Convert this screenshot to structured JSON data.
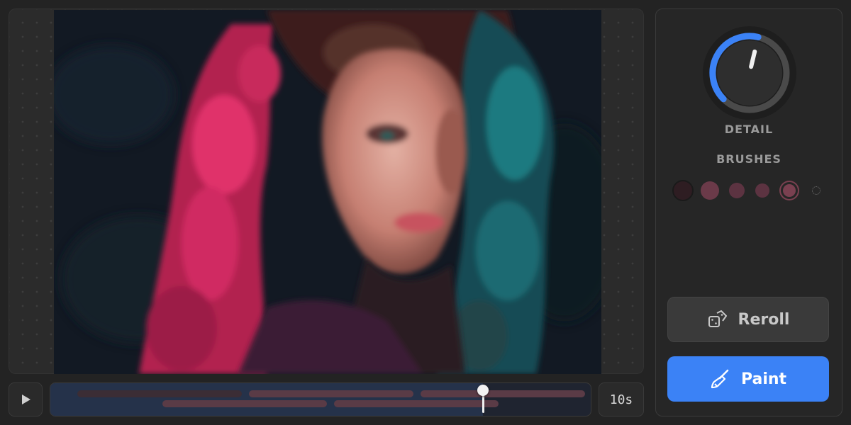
{
  "canvas": {
    "image": "painted-portrait",
    "colors": {
      "magenta": "#e0306b",
      "teal": "#1f7a80",
      "skin": "#d89a8e",
      "background": "#131a22"
    }
  },
  "player": {
    "play_icon": "play-icon",
    "duration": "10s",
    "progress": 0.8
  },
  "controls": {
    "detail_label": "DETAIL",
    "detail_level": 0.55,
    "brushes_label": "BRUSHES",
    "brushes": [
      {
        "name": "brush-1",
        "color": "#2e1d22",
        "selected": false
      },
      {
        "name": "brush-2",
        "color": "#6b3a49",
        "selected": false
      },
      {
        "name": "brush-3",
        "color": "#5c3341",
        "selected": false
      },
      {
        "name": "brush-4",
        "color": "#5c3341",
        "selected": false
      },
      {
        "name": "brush-5",
        "color": "#7a4050",
        "selected": true
      },
      {
        "name": "brush-6",
        "color": "#6a6a6a",
        "selected": false
      }
    ],
    "reroll_label": "Reroll",
    "reroll_icon": "dice-icon",
    "paint_label": "Paint",
    "paint_icon": "paintbrush-icon",
    "accent": "#3b82f6"
  }
}
